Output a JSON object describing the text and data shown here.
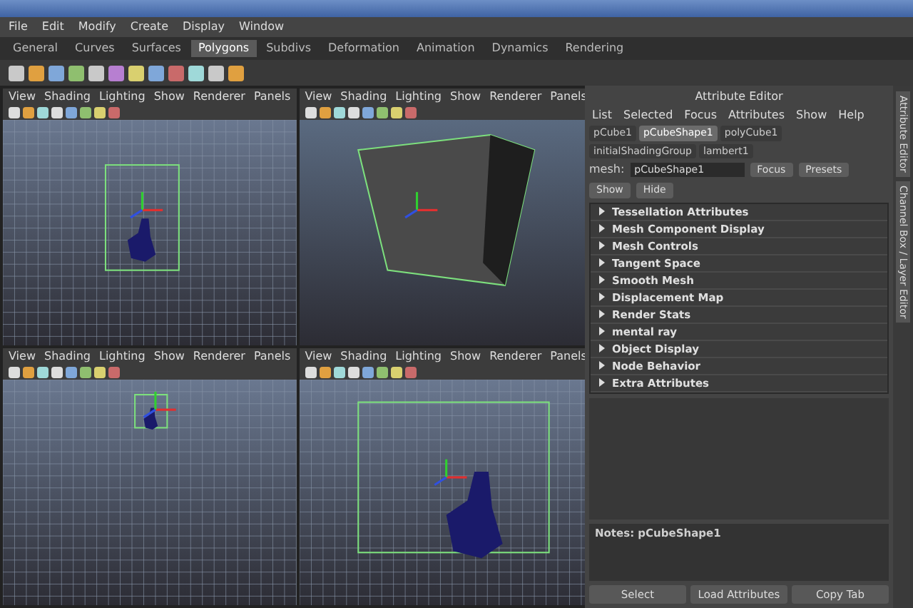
{
  "main_menu": [
    "File",
    "Edit",
    "Modify",
    "Create",
    "Display",
    "Window"
  ],
  "shelf_tabs": [
    {
      "label": "General",
      "selected": false
    },
    {
      "label": "Curves",
      "selected": false
    },
    {
      "label": "Surfaces",
      "selected": false
    },
    {
      "label": "Polygons",
      "selected": true
    },
    {
      "label": "Subdivs",
      "selected": false
    },
    {
      "label": "Deformation",
      "selected": false
    },
    {
      "label": "Animation",
      "selected": false
    },
    {
      "label": "Dynamics",
      "selected": false
    },
    {
      "label": "Rendering",
      "selected": false
    }
  ],
  "viewports": [
    {
      "kind": "figure-box",
      "menu": [
        "View",
        "Shading",
        "Lighting",
        "Show",
        "Renderer",
        "Panels"
      ]
    },
    {
      "kind": "cube",
      "menu": [
        "View",
        "Shading",
        "Lighting",
        "Show",
        "Renderer",
        "Panels"
      ]
    },
    {
      "kind": "figure-small",
      "menu": [
        "View",
        "Shading",
        "Lighting",
        "Show",
        "Renderer",
        "Panels"
      ]
    },
    {
      "kind": "figure-large",
      "menu": [
        "View",
        "Shading",
        "Lighting",
        "Show",
        "Renderer",
        "Panels"
      ]
    }
  ],
  "attribute_editor": {
    "title": "Attribute Editor",
    "menu": [
      "List",
      "Selected",
      "Focus",
      "Attributes",
      "Show",
      "Help"
    ],
    "node_tabs": [
      {
        "label": "pCube1",
        "selected": false
      },
      {
        "label": "pCubeShape1",
        "selected": true
      },
      {
        "label": "polyCube1",
        "selected": false
      },
      {
        "label": "initialShadingGroup",
        "selected": false
      },
      {
        "label": "lambert1",
        "selected": false
      }
    ],
    "buttons": [
      "Focus",
      "Presets",
      "Show",
      "Hide"
    ],
    "field": {
      "label": "mesh:",
      "value": "pCubeShape1"
    },
    "sections": [
      {
        "label": "Tessellation Attributes",
        "expanded": false
      },
      {
        "label": "Mesh Component Display",
        "expanded": false
      },
      {
        "label": "Mesh Controls",
        "expanded": false
      },
      {
        "label": "Tangent Space",
        "expanded": false
      },
      {
        "label": "Smooth Mesh",
        "expanded": false
      },
      {
        "label": "Displacement Map",
        "expanded": false
      },
      {
        "label": "Render Stats",
        "expanded": false
      },
      {
        "label": "mental ray",
        "expanded": false
      },
      {
        "label": "Object Display",
        "expanded": false
      },
      {
        "label": "Node Behavior",
        "expanded": false
      },
      {
        "label": "Extra Attributes",
        "expanded": false
      }
    ],
    "notes": "Notes: pCubeShape1",
    "bottom_buttons": [
      "Select",
      "Load Attributes",
      "Copy Tab"
    ]
  },
  "side_tabs": [
    "Attribute Editor",
    "Channel Box / Layer Editor"
  ]
}
